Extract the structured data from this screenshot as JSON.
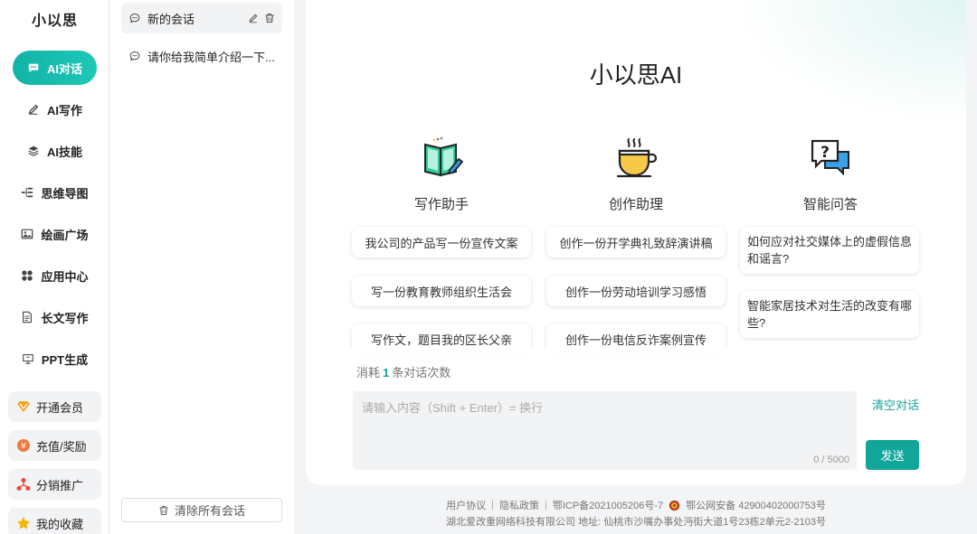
{
  "brand": "小以思",
  "nav": {
    "items": [
      {
        "label": "AI对话",
        "icon": "chat-icon"
      },
      {
        "label": "AI写作",
        "icon": "pen-icon"
      },
      {
        "label": "AI技能",
        "icon": "layers-icon"
      },
      {
        "label": "思维导图",
        "icon": "mindmap-icon"
      },
      {
        "label": "绘画广场",
        "icon": "image-icon"
      },
      {
        "label": "应用中心",
        "icon": "apps-icon"
      },
      {
        "label": "长文写作",
        "icon": "document-icon"
      },
      {
        "label": "PPT生成",
        "icon": "presentation-icon"
      }
    ],
    "sub": [
      {
        "label": "开通会员",
        "icon": "vip-icon"
      },
      {
        "label": "充值/奖励",
        "icon": "coin-icon"
      },
      {
        "label": "分销推广",
        "icon": "share-icon"
      },
      {
        "label": "我的收藏",
        "icon": "star-icon"
      }
    ]
  },
  "conversations": {
    "items": [
      {
        "title": "新的会话"
      },
      {
        "title": "请你给我简单介绍一下..."
      }
    ],
    "clear_all": "清除所有会话"
  },
  "main": {
    "title": "小以思AI",
    "columns": [
      {
        "heading": "写作助手",
        "icon": "book-pen-icon",
        "suggestions": [
          "我公司的产品写一份宣传文案",
          "写一份教育教师组织生活会",
          "写作文，题目我的区长父亲"
        ]
      },
      {
        "heading": "创作助理",
        "icon": "coffee-cup-icon",
        "suggestions": [
          "创作一份开学典礼致辞演讲稿",
          "创作一份劳动培训学习感悟",
          "创作一份电信反诈案例宣传"
        ]
      },
      {
        "heading": "智能问答",
        "icon": "question-chat-icon",
        "suggestions": [
          "如何应对社交媒体上的虚假信息和谣言?",
          "智能家居技术对生活的改变有哪些?"
        ]
      }
    ],
    "usage": {
      "prefix": "消耗",
      "count": "1",
      "suffix": "条对话次数"
    },
    "input": {
      "placeholder": "请输入内容（Shift + Enter）= 换行",
      "counter": "0 / 5000"
    },
    "clear_conversation": "清空对话",
    "send": "发送"
  },
  "footer": {
    "user_agreement": "用户协议",
    "privacy": "隐私政策",
    "icp": "鄂ICP备2021005206号-7",
    "police": "鄂公网安备 42900402000753号",
    "company": "湖北爱改重网络科技有限公司",
    "address": "地址: 仙桃市沙嘴办事处沔街大道1号23栋2单元2-2103号"
  },
  "colors": {
    "accent": "#12a69b",
    "accent_light": "#1ec8b6",
    "background": "#f3f4f6"
  }
}
